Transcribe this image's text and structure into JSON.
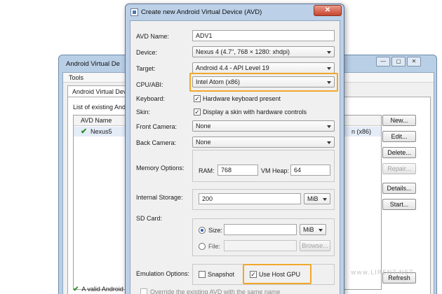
{
  "background_window": {
    "title": "Android Virtual De",
    "controls": {
      "minimize": "—",
      "maximize": "▢",
      "close": "✕"
    },
    "menu": "Tools",
    "tab": "Android Virtual Devic",
    "list_label": "List of existing Andro",
    "table": {
      "column_avd_name": "AVD Name",
      "row_name": "Nexus5",
      "row_cpu_fragment": "n (x86)"
    },
    "buttons": {
      "new": "New...",
      "edit": "Edit...",
      "delete": "Delete...",
      "repair": "Repair...",
      "details": "Details...",
      "start": "Start...",
      "refresh": "Refresh"
    },
    "valid_message": "A valid Android"
  },
  "dialog": {
    "title": "Create new Android Virtual Device (AVD)",
    "close_glyph": "✕",
    "fields": {
      "avd_name_label": "AVD Name:",
      "avd_name_value": "ADV1",
      "device_label": "Device:",
      "device_value": "Nexus 4 (4.7\", 768 × 1280: xhdpi)",
      "target_label": "Target:",
      "target_value": "Android 4.4 - API Level 19",
      "cpu_label": "CPU/ABI:",
      "cpu_value": "Intel Atom (x86)",
      "keyboard_label": "Keyboard:",
      "keyboard_option": "Hardware keyboard present",
      "skin_label": "Skin:",
      "skin_option": "Display a skin with hardware controls",
      "front_camera_label": "Front Camera:",
      "front_camera_value": "None",
      "back_camera_label": "Back Camera:",
      "back_camera_value": "None",
      "memory_label": "Memory Options:",
      "ram_label": "RAM:",
      "ram_value": "768",
      "vmheap_label": "VM Heap:",
      "vmheap_value": "64",
      "storage_label": "Internal Storage:",
      "storage_value": "200",
      "storage_unit": "MiB",
      "sdcard_label": "SD Card:",
      "size_label": "Size:",
      "size_value": "",
      "size_unit": "MiB",
      "file_label": "File:",
      "file_value": "",
      "browse": "Browse...",
      "emulation_label": "Emulation Options:",
      "snapshot_option": "Snapshot",
      "host_gpu_option": "Use Host GPU",
      "override_option": "Override the existing AVD with the same name"
    },
    "states": {
      "keyboard_checked": true,
      "skin_checked": true,
      "snapshot_checked": false,
      "host_gpu_checked": true,
      "override_checked": false
    }
  },
  "watermark": "www.LIRENT.NET",
  "colors": {
    "highlight": "#f2a72a",
    "window_frame": "#bcd1e8",
    "check_green": "#2e8b2e"
  }
}
